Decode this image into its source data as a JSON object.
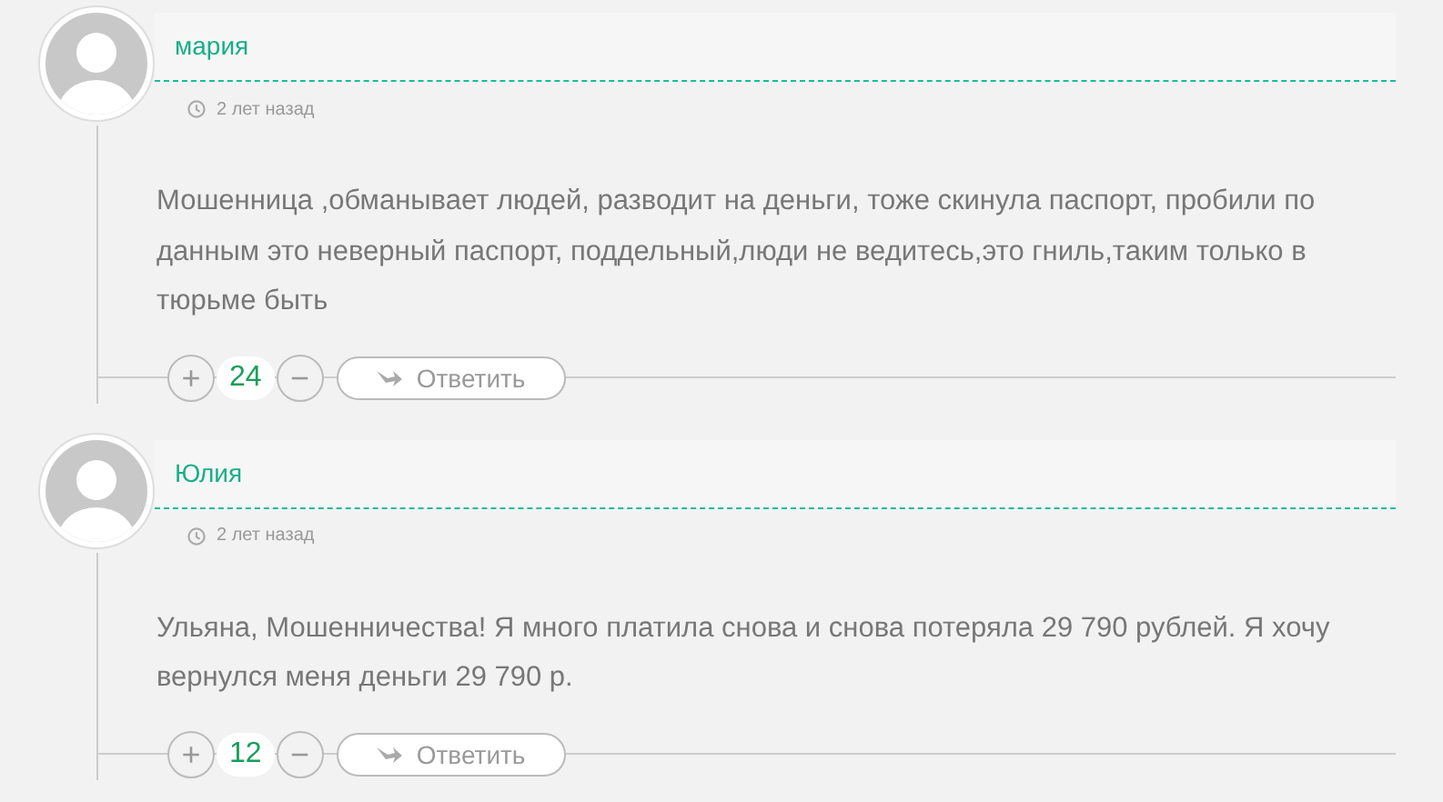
{
  "comments": [
    {
      "author": "мария",
      "time": "2 лет назад",
      "text": "Мошенница ,обманывает людей, разводит на деньги, тоже скинула паспорт, пробили по данным это неверный паспорт, поддельный,люди не ведитесь,это гниль,таким только в тюрьме быть",
      "plus": "+",
      "votes": "24",
      "minus": "−",
      "reply": "Ответить"
    },
    {
      "author": "Юлия",
      "time": "2 лет назад",
      "text": "Ульяна, Мошенничества! Я много платила снова и снова потеряла 29 790 рублей. Я хочу вернулся меня деньги 29 790 р.",
      "plus": "+",
      "votes": "12",
      "minus": "−",
      "reply": "Ответить"
    }
  ]
}
